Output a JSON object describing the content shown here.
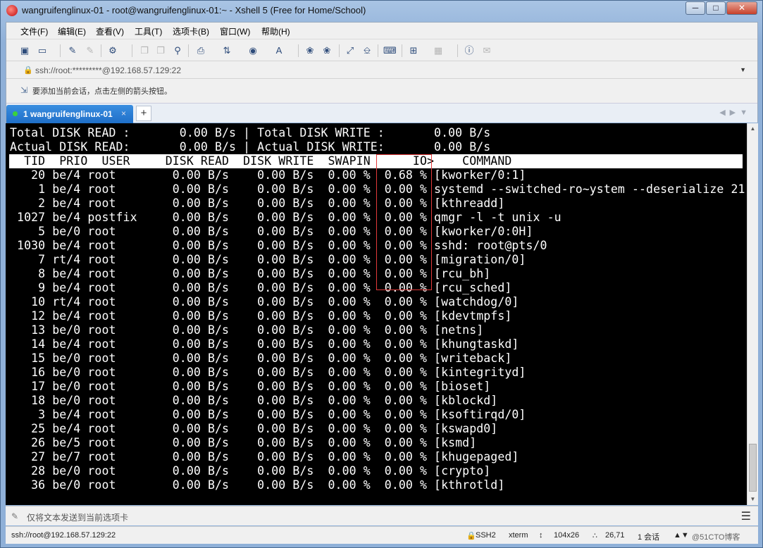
{
  "window": {
    "title": "wangruifenglinux-01 - root@wangruifenglinux-01:~ - Xshell 5 (Free for Home/School)",
    "minimize_icon": "minimize-icon",
    "maximize_icon": "maximize-icon",
    "close_icon": "close-icon"
  },
  "menu": {
    "items": [
      "文件(F)",
      "编辑(E)",
      "查看(V)",
      "工具(T)",
      "选项卡(B)",
      "窗口(W)",
      "帮助(H)"
    ]
  },
  "address": {
    "value": "ssh://root:*********@192.168.57.129:22"
  },
  "tip": {
    "text": "要添加当前会话，点击左侧的箭头按钮。"
  },
  "tabs": {
    "active_label": "1 wangruifenglinux-01",
    "close_glyph": "×",
    "add_glyph": "+"
  },
  "terminal": {
    "lines": [
      "Total DISK READ :       0.00 B/s | Total DISK WRITE :       0.00 B/s",
      "Actual DISK READ:       0.00 B/s | Actual DISK WRITE:       0.00 B/s",
      "  TID  PRIO  USER     DISK READ  DISK WRITE  SWAPIN      IO>    COMMAND",
      "   20 be/4 root        0.00 B/s    0.00 B/s  0.00 %  0.68 % [kworker/0:1]",
      "    1 be/4 root        0.00 B/s    0.00 B/s  0.00 %  0.00 % systemd --switched-ro~ystem --deserialize 21",
      "    2 be/4 root        0.00 B/s    0.00 B/s  0.00 %  0.00 % [kthreadd]",
      " 1027 be/4 postfix     0.00 B/s    0.00 B/s  0.00 %  0.00 % qmgr -l -t unix -u",
      "    5 be/0 root        0.00 B/s    0.00 B/s  0.00 %  0.00 % [kworker/0:0H]",
      " 1030 be/4 root        0.00 B/s    0.00 B/s  0.00 %  0.00 % sshd: root@pts/0",
      "    7 rt/4 root        0.00 B/s    0.00 B/s  0.00 %  0.00 % [migration/0]",
      "    8 be/4 root        0.00 B/s    0.00 B/s  0.00 %  0.00 % [rcu_bh]",
      "    9 be/4 root        0.00 B/s    0.00 B/s  0.00 %  0.00 % [rcu_sched]",
      "   10 rt/4 root        0.00 B/s    0.00 B/s  0.00 %  0.00 % [watchdog/0]",
      "   12 be/4 root        0.00 B/s    0.00 B/s  0.00 %  0.00 % [kdevtmpfs]",
      "   13 be/0 root        0.00 B/s    0.00 B/s  0.00 %  0.00 % [netns]",
      "   14 be/4 root        0.00 B/s    0.00 B/s  0.00 %  0.00 % [khungtaskd]",
      "   15 be/0 root        0.00 B/s    0.00 B/s  0.00 %  0.00 % [writeback]",
      "   16 be/0 root        0.00 B/s    0.00 B/s  0.00 %  0.00 % [kintegrityd]",
      "   17 be/0 root        0.00 B/s    0.00 B/s  0.00 %  0.00 % [bioset]",
      "   18 be/0 root        0.00 B/s    0.00 B/s  0.00 %  0.00 % [kblockd]",
      "    3 be/4 root        0.00 B/s    0.00 B/s  0.00 %  0.00 % [ksoftirqd/0]",
      "   25 be/4 root        0.00 B/s    0.00 B/s  0.00 %  0.00 % [kswapd0]",
      "   26 be/5 root        0.00 B/s    0.00 B/s  0.00 %  0.00 % [ksmd]",
      "   27 be/7 root        0.00 B/s    0.00 B/s  0.00 %  0.00 % [khugepaged]",
      "   28 be/0 root        0.00 B/s    0.00 B/s  0.00 %  0.00 % [crypto]",
      "   36 be/0 root        0.00 B/s    0.00 B/s  0.00 %  0.00 % [kthrotld]"
    ],
    "header_line_index": 2,
    "colors": {
      "background": "#000000",
      "foreground": "#ffffff",
      "header_bg": "#ffffff",
      "highlight_box": "#e23a3a"
    }
  },
  "compose": {
    "text": "仅将文本发送到当前选项卡"
  },
  "status": {
    "connection": "ssh://root@192.168.57.129:22",
    "protocol": "SSH2",
    "term": "xterm",
    "size": "104x26",
    "cursor": "26,71",
    "sessions": "1 会话",
    "watermark": "@51CTO博客"
  }
}
